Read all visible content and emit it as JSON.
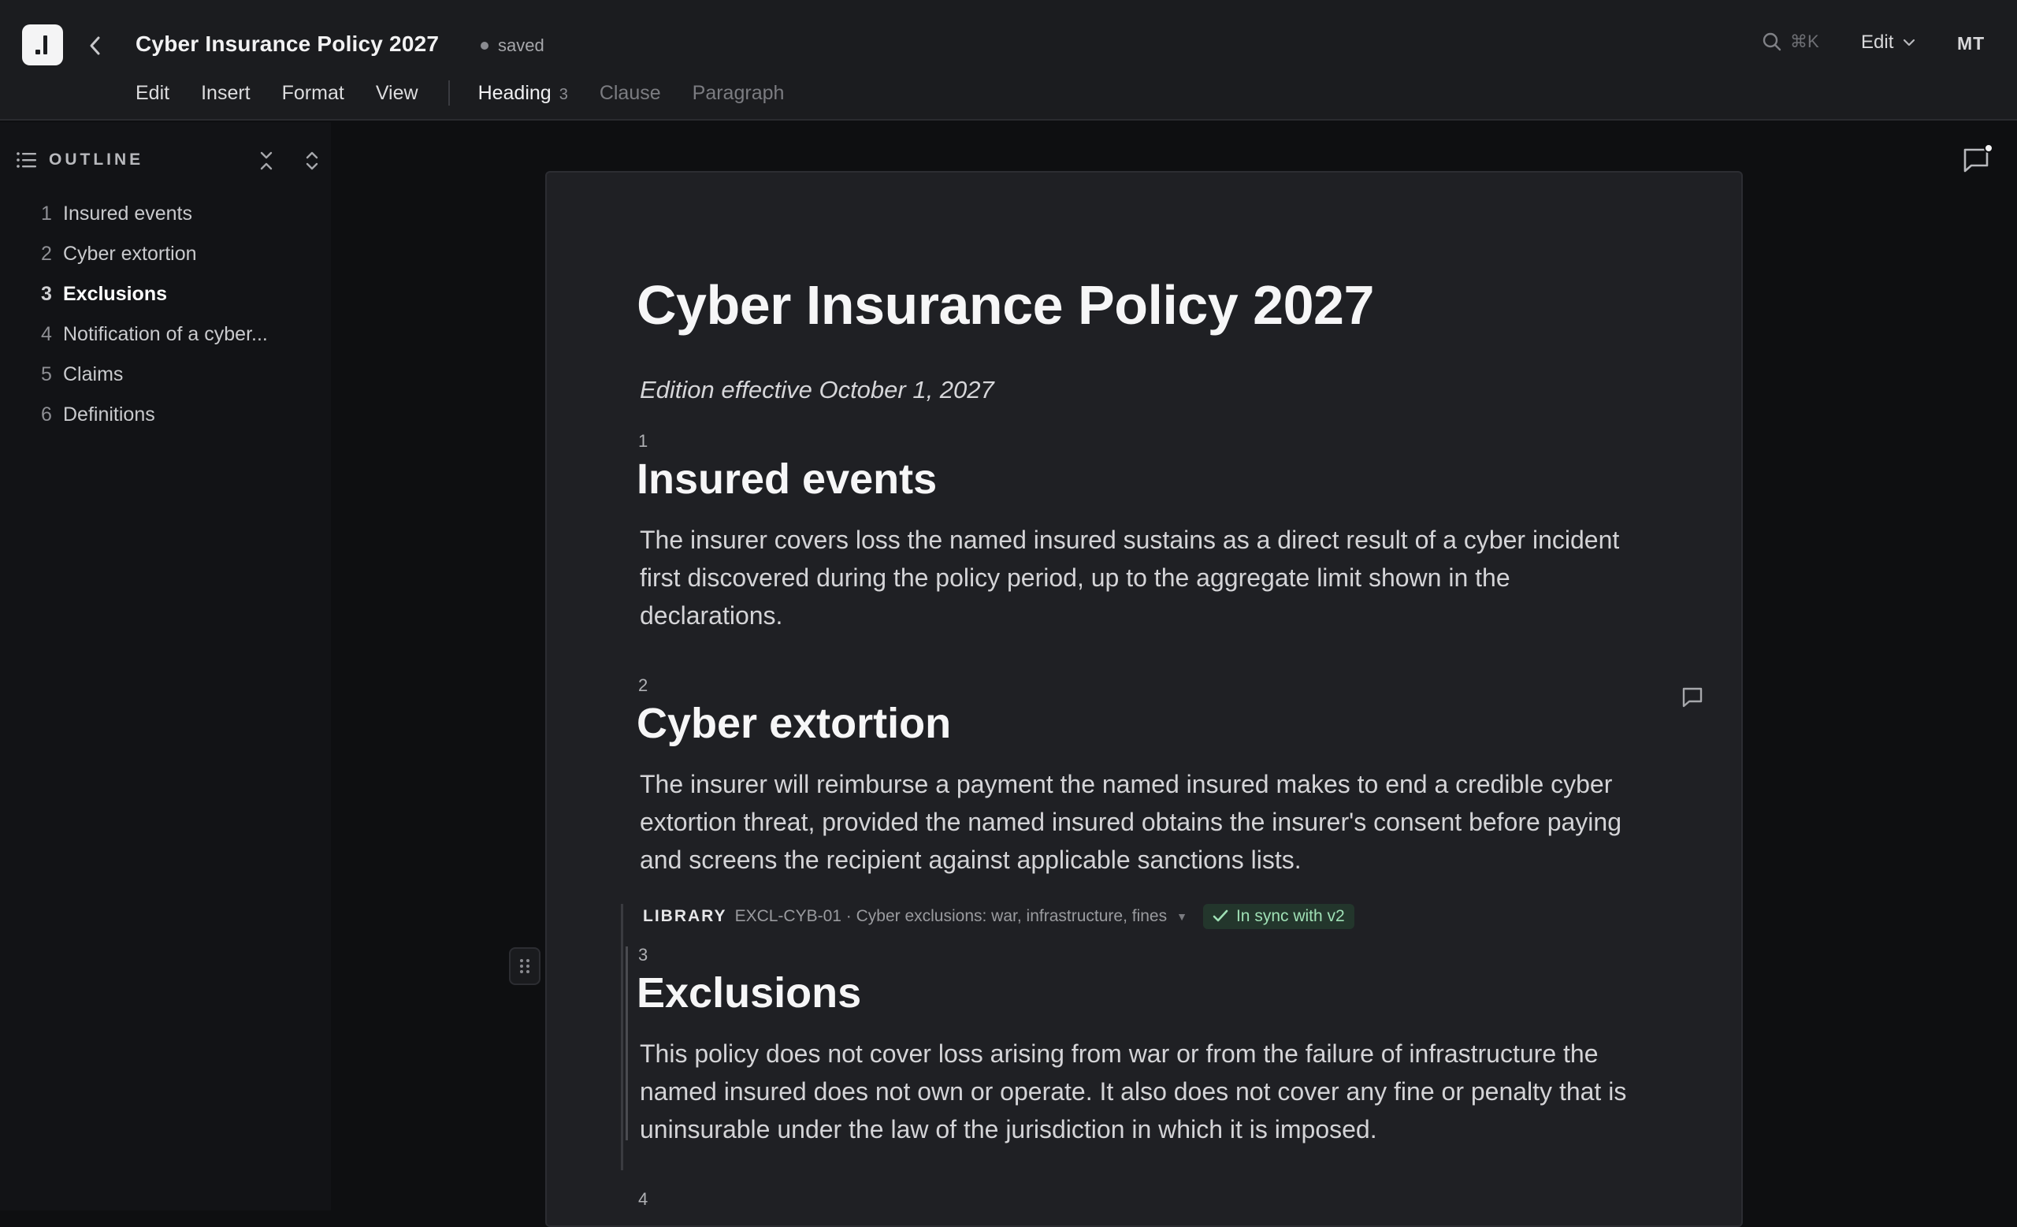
{
  "header": {
    "title": "Cyber Insurance Policy 2027",
    "save_status": "saved",
    "search_shortcut": "⌘K",
    "mode_label": "Edit",
    "avatar_initials": "MT"
  },
  "menu": {
    "items": [
      "Edit",
      "Insert",
      "Format",
      "View"
    ],
    "styles": [
      {
        "label": "Heading",
        "sub": "3"
      },
      {
        "label": "Clause"
      },
      {
        "label": "Paragraph"
      }
    ]
  },
  "outline": {
    "title": "OUTLINE",
    "items": [
      {
        "num": "1",
        "label": "Insured events"
      },
      {
        "num": "2",
        "label": "Cyber extortion"
      },
      {
        "num": "3",
        "label": "Exclusions"
      },
      {
        "num": "4",
        "label": "Notification of a cyber..."
      },
      {
        "num": "5",
        "label": "Claims"
      },
      {
        "num": "6",
        "label": "Definitions"
      }
    ],
    "active_index": 2
  },
  "document": {
    "title": "Cyber Insurance Policy 2027",
    "edition": "Edition effective October 1, 2027",
    "sections": [
      {
        "num": "1",
        "title": "Insured events",
        "body": "The insurer covers loss the named insured sustains as a direct result of a cyber incident first discovered during the policy period, up to the aggregate limit shown in the declarations."
      },
      {
        "num": "2",
        "title": "Cyber extortion",
        "body": "The insurer will reimburse a payment the named insured makes to end a credible cyber extortion threat, provided the named insured obtains the insurer's consent before paying and screens the recipient against applicable sanctions lists."
      },
      {
        "num": "3",
        "title": "Exclusions",
        "body": "This policy does not cover loss arising from war or from the failure of infrastructure the named insured does not own or operate. It also does not cover any fine or penalty that is uninsurable under the law of the jurisdiction in which it is imposed."
      },
      {
        "num": "4"
      }
    ],
    "library": {
      "tag": "LIBRARY",
      "ref": "EXCL-CYB-01 · Cyber exclusions: war, infrastructure, fines",
      "sync_label": "In sync with v2"
    }
  },
  "colors": {
    "background": "#0e0f11",
    "page": "#1f2024",
    "sync_green": "#9fe0b5"
  }
}
